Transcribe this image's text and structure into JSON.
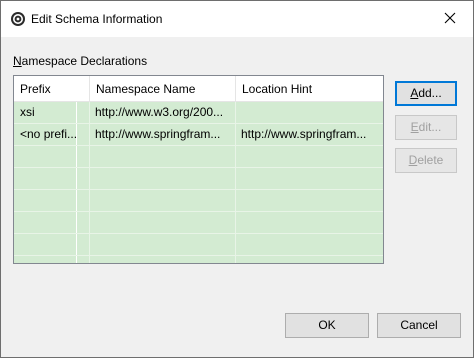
{
  "window": {
    "title": "Edit Schema Information"
  },
  "section": {
    "label": "Namespace Declarations",
    "mnemonic": "N",
    "rest": "amespace Declarations"
  },
  "table": {
    "columns": [
      "Prefix",
      "Namespace Name",
      "Location Hint"
    ],
    "rows": [
      [
        "xsi",
        "http://www.w3.org/200...",
        ""
      ],
      [
        "<no prefi...",
        "http://www.springfram...",
        "http://www.springfram..."
      ]
    ],
    "empty_row_count": 5
  },
  "buttons": {
    "add": {
      "mnemonic": "A",
      "rest": "dd...",
      "label": "Add..."
    },
    "edit": {
      "mnemonic": "E",
      "rest": "dit...",
      "label": "Edit..."
    },
    "delete": {
      "mnemonic": "D",
      "rest": "elete",
      "label": "Delete"
    },
    "ok": "OK",
    "cancel": "Cancel"
  },
  "colors": {
    "row_background": "#d3ebd2",
    "focus_border": "#0078d7"
  }
}
